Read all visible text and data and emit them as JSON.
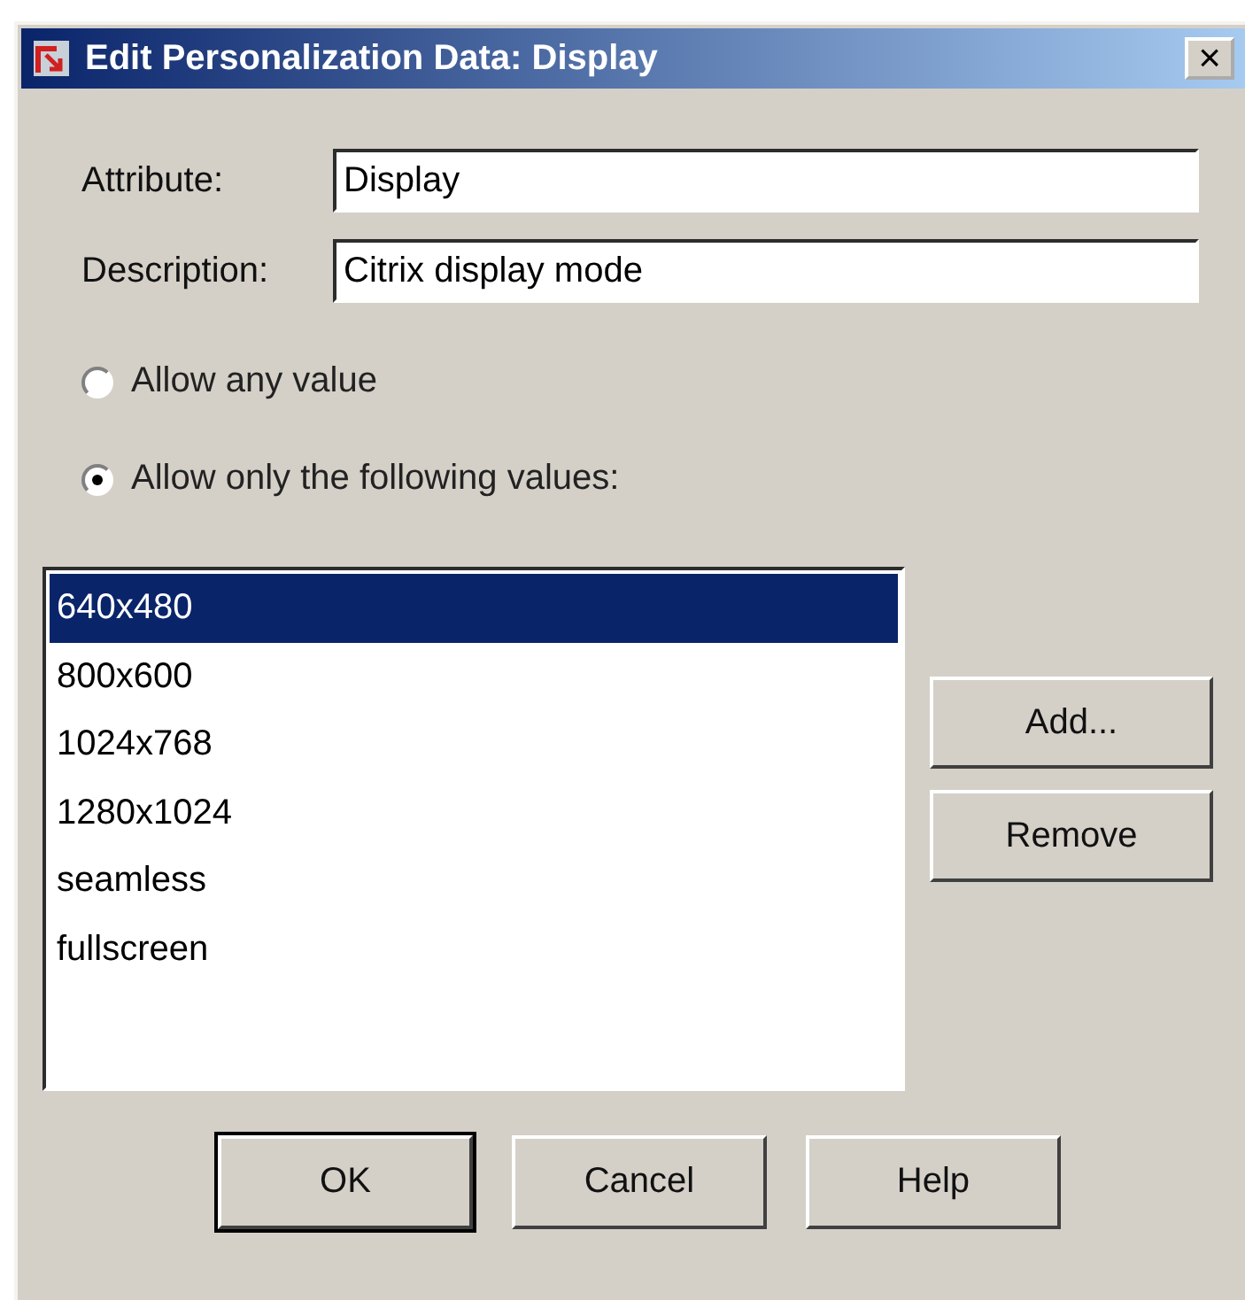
{
  "window": {
    "title": "Edit Personalization Data: Display",
    "close": "×"
  },
  "fields": [
    {
      "label": "Attribute:",
      "value": "Display"
    },
    {
      "label": "Description:",
      "value": "Citrix display mode"
    }
  ],
  "radios": [
    {
      "label": "Allow any value",
      "selected": false
    },
    {
      "label": "Allow only the following values:",
      "selected": true
    }
  ],
  "values": [
    {
      "label": "640x480",
      "selected": true
    },
    {
      "label": "800x600",
      "selected": false
    },
    {
      "label": "1024x768",
      "selected": false
    },
    {
      "label": "1280x1024",
      "selected": false
    },
    {
      "label": "seamless",
      "selected": false
    },
    {
      "label": "fullscreen",
      "selected": false
    }
  ],
  "side_buttons": [
    "Add...",
    "Remove"
  ],
  "buttons": [
    {
      "label": "OK",
      "default": true
    },
    {
      "label": "Cancel",
      "default": false
    },
    {
      "label": "Help",
      "default": false
    }
  ]
}
